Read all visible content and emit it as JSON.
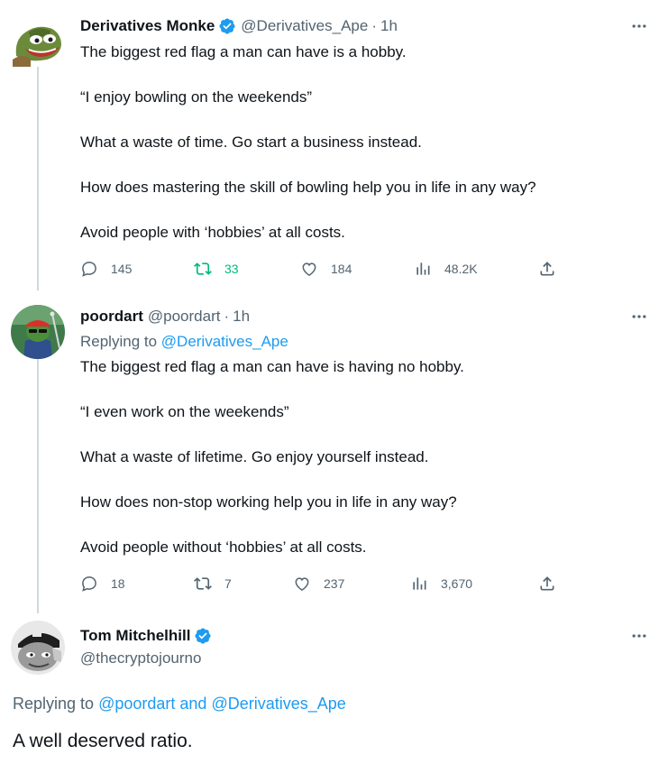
{
  "tweets": [
    {
      "name": "Derivatives Monke",
      "handle": "@Derivatives_Ape",
      "time": "1h",
      "verified": true,
      "lines": [
        "The biggest red flag a man can have is a hobby.",
        "",
        "“I enjoy bowling on the weekends”",
        "",
        "What a waste of time. Go start a business instead.",
        "",
        "How does mastering the skill of bowling help you in life in any way?",
        "",
        "Avoid people with ‘hobbies’ at all costs."
      ],
      "replies": "145",
      "retweets": "33",
      "likes": "184",
      "views": "48.2K",
      "retweet_color": "#00ba7c"
    },
    {
      "name": "poordart",
      "handle": "@poordart",
      "time": "1h",
      "verified": false,
      "replying_label": "Replying to ",
      "replying_to": "@Derivatives_Ape",
      "lines": [
        "The biggest red flag a man can have is  having no hobby.",
        "",
        "“I even work on the weekends”",
        "",
        "What a waste of lifetime. Go enjoy yourself instead.",
        "",
        "How does non-stop working help you in life in any way?",
        "",
        "Avoid people without ‘hobbies’ at all costs."
      ],
      "replies": "18",
      "retweets": "7",
      "likes": "237",
      "views": "3,670"
    },
    {
      "name": "Tom Mitchelhill",
      "handle": "@thecryptojourno",
      "verified": true,
      "replying_label": "Replying to ",
      "replying_to_1": "@poordart",
      "replying_and": " and ",
      "replying_to_2": "@Derivatives_Ape",
      "text": "A well deserved ratio."
    }
  ],
  "colors": {
    "accent": "#1d9bf0",
    "secondary_text": "#536471",
    "thread_line": "#cfd9de"
  },
  "icons": {
    "verified": "verified-badge-icon",
    "more": "more-options-icon",
    "reply": "reply-icon",
    "retweet": "retweet-icon",
    "like": "like-icon",
    "views": "views-icon",
    "share": "share-icon"
  }
}
